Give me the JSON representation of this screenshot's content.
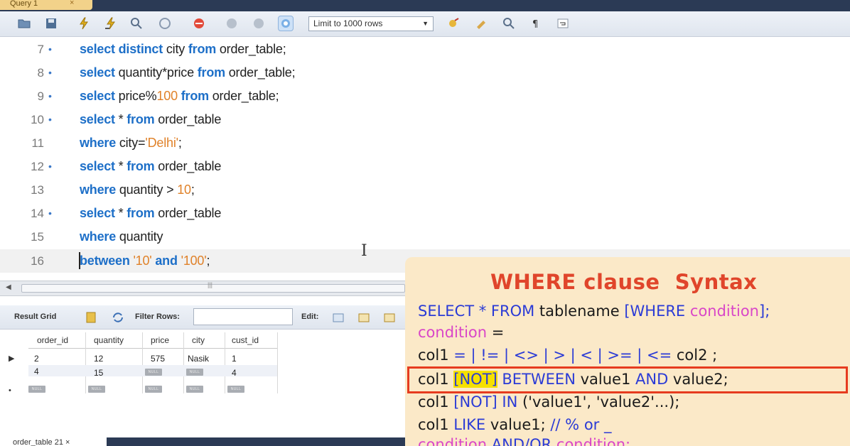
{
  "tab": {
    "label": "Query 1",
    "close": "×"
  },
  "toolbar": {
    "icons": [
      "folder-open-icon",
      "save-icon",
      "execute-icon",
      "execute-line-icon",
      "explain-icon",
      "stop-icon",
      "toggle-error-icon",
      "commit-icon",
      "rollback-icon",
      "autocommit-icon"
    ],
    "limit_value": "Limit to 1000 rows",
    "right_icons": [
      "beautify-icon",
      "find-icon",
      "search-icon",
      "invisible-chars-icon",
      "wrap-icon"
    ]
  },
  "editor": {
    "lines": [
      {
        "num": "7",
        "dot": "•"
      },
      {
        "num": "8",
        "dot": "•"
      },
      {
        "num": "9",
        "dot": "•"
      },
      {
        "num": "10",
        "dot": "•"
      },
      {
        "num": "11",
        "dot": ""
      },
      {
        "num": "12",
        "dot": "•"
      },
      {
        "num": "13",
        "dot": ""
      },
      {
        "num": "14",
        "dot": "•"
      },
      {
        "num": "15",
        "dot": ""
      },
      {
        "num": "16",
        "dot": ""
      }
    ],
    "tokens": {
      "l7": [
        "select distinct",
        " city ",
        "from",
        " order_table;"
      ],
      "l8": [
        "select",
        " quantity*price ",
        "from",
        " order_table;"
      ],
      "l9": [
        "select",
        " price%",
        "100",
        " ",
        "from",
        " order_table;"
      ],
      "l10": [
        "select",
        " * ",
        "from",
        " order_table"
      ],
      "l11": [
        "where",
        " city=",
        "'Delhi'",
        ";"
      ],
      "l12": [
        "select",
        " * ",
        "from",
        " order_table"
      ],
      "l13": [
        "where",
        " quantity > ",
        "10",
        ";"
      ],
      "l14": [
        "select",
        " * ",
        "from",
        " order_table"
      ],
      "l15": [
        "where",
        " quantity"
      ],
      "l16": [
        "between",
        " ",
        "'10'",
        " ",
        "and",
        " ",
        "'100'",
        ";"
      ]
    }
  },
  "results": {
    "result_grid_label": "Result Grid",
    "filter_label": "Filter Rows:",
    "edit_label": "Edit:",
    "columns": [
      "order_id",
      "quantity",
      "price",
      "city",
      "cust_id"
    ],
    "rows": [
      [
        "2",
        "12",
        "575",
        "Nasik",
        "1"
      ],
      [
        "4",
        "15",
        "NULL",
        "NULL",
        "4"
      ],
      [
        "NULL",
        "NULL",
        "NULL",
        "NULL",
        "NULL"
      ]
    ],
    "row_markers": [
      "▶",
      "",
      "•"
    ]
  },
  "bottom_tab": "order_table 21 ×",
  "syntax_panel": {
    "title": "WHERE clause  Syntax",
    "l1": [
      "SELECT * FROM",
      " tablename ",
      "[WHERE",
      " condition",
      "];"
    ],
    "l2": [
      "condition",
      " ="
    ],
    "l3": [
      "col1 ",
      "= | != | <> | > | < | >= | <=",
      " col2 ;"
    ],
    "l4": [
      "col1 ",
      "[NOT]",
      " BETWEEN",
      " value1 ",
      "AND",
      " value2;"
    ],
    "l5": [
      "col1 ",
      "[NOT] IN",
      " ('value1', 'value2'...);"
    ],
    "l6": [
      "col1 ",
      "LIKE",
      " value1; ",
      "// % or _"
    ],
    "l7": [
      "condition",
      " AND/OR ",
      "condition;"
    ]
  },
  "colors": {
    "keyword": "#1d6fc8",
    "literal": "#e0822a",
    "panel_bg": "#fbe9c8",
    "panel_title": "#e0452b",
    "panel_blue": "#2b3bd6",
    "panel_magenta": "#d946c8",
    "highlight_box": "#e63b1f"
  }
}
